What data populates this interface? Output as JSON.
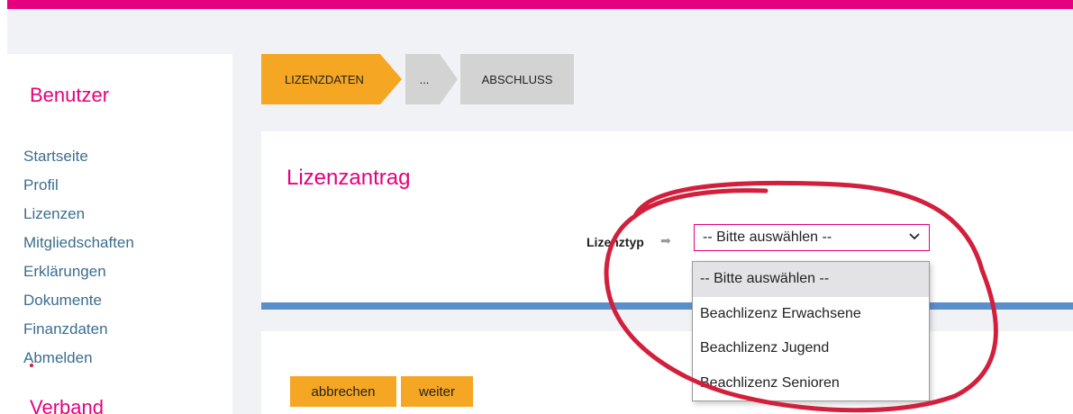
{
  "colors": {
    "brand": "#e6007e",
    "step_active": "#f5a623",
    "step_inactive": "#d3d3d3",
    "link": "#3a6e8f",
    "divider_blue": "#5b8fcb",
    "annotation_red": "#d21f3c"
  },
  "sidebar": {
    "title": "Benutzer",
    "items": [
      {
        "label": "Startseite"
      },
      {
        "label": "Profil"
      },
      {
        "label": "Lizenzen"
      },
      {
        "label": "Mitgliedschaften"
      },
      {
        "label": "Erklärungen"
      },
      {
        "label": "Dokumente"
      },
      {
        "label": "Finanzdaten"
      },
      {
        "label": "Abmelden"
      }
    ],
    "title2": "Verband"
  },
  "steps": [
    {
      "label": "LIZENZDATEN",
      "active": true
    },
    {
      "label": "...",
      "active": false
    },
    {
      "label": "ABSCHLUSS",
      "active": false
    }
  ],
  "form": {
    "title": "Lizenzantrag",
    "field_label": "Lizenztyp",
    "arrow_icon": "arrow-right-icon",
    "select_value": "-- Bitte auswählen --",
    "options": [
      "-- Bitte auswählen --",
      "Beachlizenz Erwachsene",
      "Beachlizenz Jugend",
      "Beachlizenz Senioren"
    ]
  },
  "buttons": {
    "cancel": "abbrechen",
    "next": "weiter"
  }
}
